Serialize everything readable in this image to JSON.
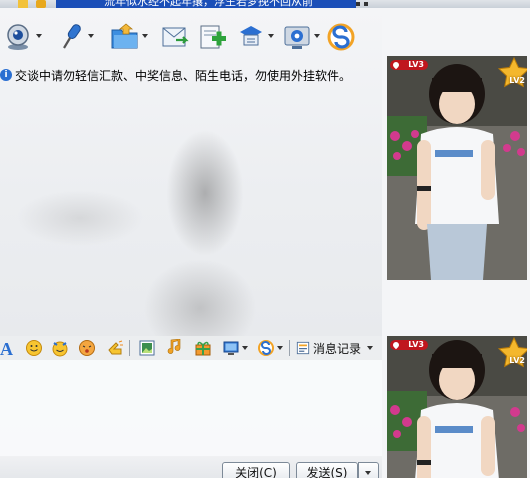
{
  "status_bar": {
    "marquee_text": "流年似水经不起年攘，浮生若梦挽不回从前"
  },
  "toolbar": {
    "items": [
      "video-call-icon",
      "voice-call-icon",
      "send-file-icon",
      "send-email-icon",
      "create-group-icon",
      "app-menu-icon",
      "settings-icon",
      "s-service-icon"
    ]
  },
  "notice": {
    "text": "交谈中请勿轻信汇款、中奖信息、陌生电话，勿使用外挂软件。"
  },
  "format_bar": {
    "font_label": "A",
    "history_label": "消息记录"
  },
  "buttons": {
    "close_label": "关闭(C)",
    "send_label": "发送(S)"
  },
  "profile": {
    "badge_level": "LV3",
    "star_level": "LV2"
  },
  "colors": {
    "accent": "#2b6fd1",
    "marquee_bg": "#1b4fb8",
    "badge_red": "#c0161e"
  }
}
